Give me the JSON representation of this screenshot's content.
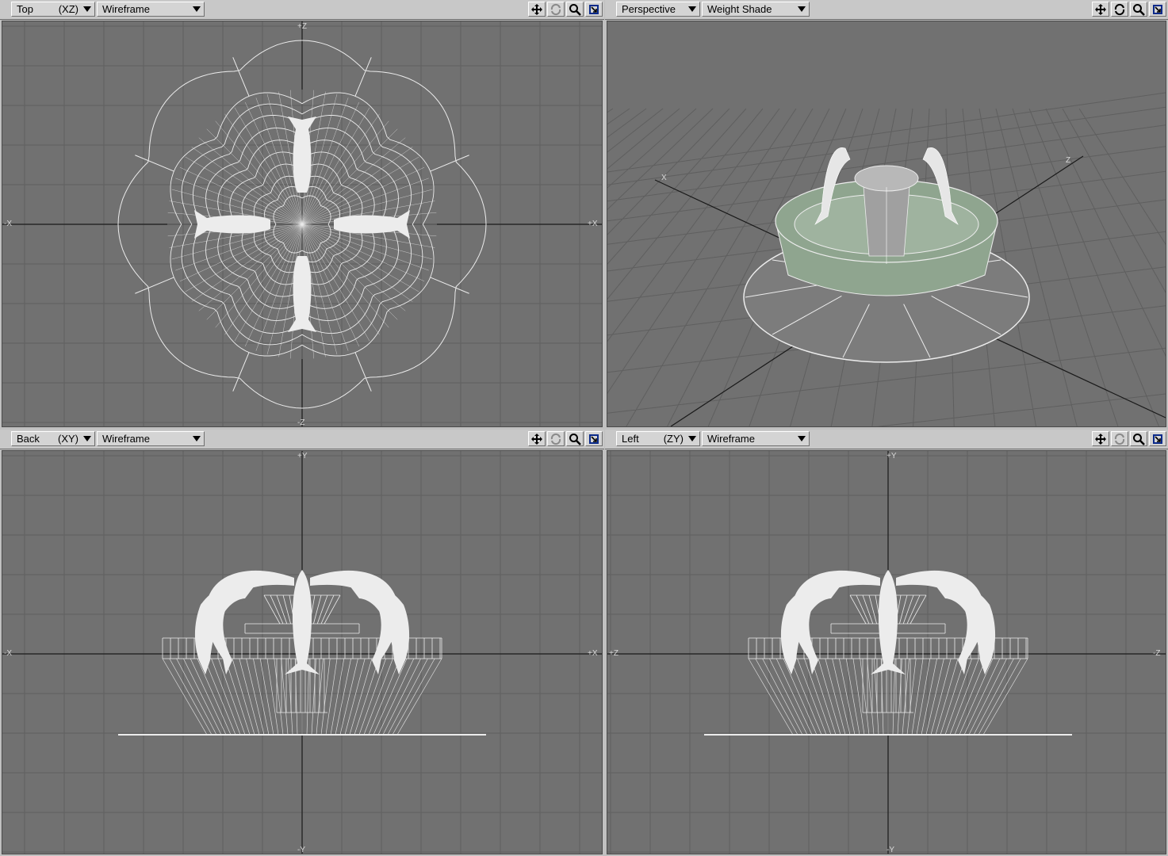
{
  "viewports": {
    "top": {
      "view": "Top",
      "axis": "(XZ)",
      "mode": "Wireframe"
    },
    "persp": {
      "view": "Perspective",
      "axis": "",
      "mode": "Weight Shade"
    },
    "back": {
      "view": "Back",
      "axis": "(XY)",
      "mode": "Wireframe"
    },
    "left": {
      "view": "Left",
      "axis": "(ZY)",
      "mode": "Wireframe"
    }
  },
  "axis_labels": {
    "top": {
      "left": "-X",
      "right": "+X",
      "up": "+Z",
      "down": "-Z"
    },
    "persp": {
      "x": "X",
      "z": "Z"
    },
    "back": {
      "left": "-X",
      "right": "+X",
      "up": "+Y",
      "down": "-Y"
    },
    "left": {
      "left": "+Z",
      "right": "-Z",
      "up": "+Y",
      "down": "-Y"
    }
  },
  "tools": [
    "move-icon",
    "rotate-icon",
    "zoom-icon",
    "maximize-icon"
  ],
  "colors": {
    "viewport_bg": "#717171",
    "grid": "#5f5f5f",
    "axis": "#1a1a1a",
    "wire": "#ececec",
    "shade": "#8fa58f"
  }
}
